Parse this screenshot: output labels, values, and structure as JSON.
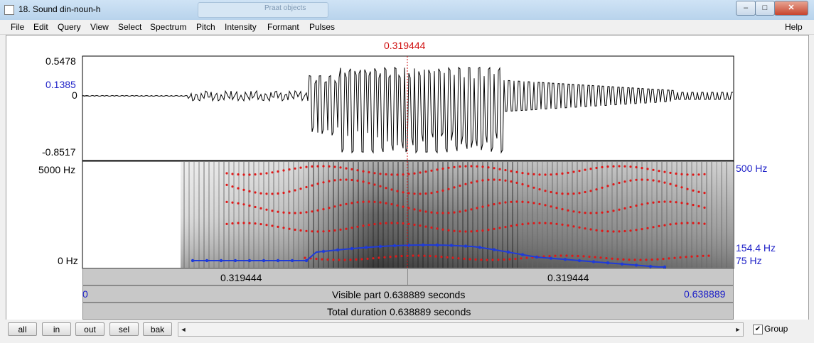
{
  "window": {
    "title": "18. Sound din-noun-h",
    "ghost_tab_label": "Praat objects",
    "min_symbol": "–",
    "max_symbol": "□",
    "close_symbol": "✕"
  },
  "menu": {
    "items": [
      "File",
      "Edit",
      "Query",
      "View",
      "Select",
      "Spectrum",
      "Pitch",
      "Intensity",
      "Formant",
      "Pulses"
    ],
    "help": "Help"
  },
  "waveform": {
    "cursor_time_label": "0.319444",
    "y_max_label": "0.5478",
    "y_cursor_value_label": "0.1385",
    "y_zero_label": "0",
    "y_min_label": "-0.8517"
  },
  "spectrogram": {
    "freq_max_label": "5000 Hz",
    "freq_min_label": "0 Hz",
    "pitch_max_label": "500 Hz",
    "pitch_cursor_label": "154.4 Hz",
    "pitch_min_label": "75 Hz"
  },
  "selection_bar": {
    "left_duration": "0.319444",
    "right_duration": "0.319444"
  },
  "visible_bar": {
    "start": "0",
    "label": "Visible part 0.638889 seconds",
    "end": "0.638889"
  },
  "total_bar": {
    "label": "Total duration 0.638889 seconds"
  },
  "toolbar": {
    "buttons": [
      "all",
      "in",
      "out",
      "sel",
      "bak"
    ],
    "scroll_left_symbol": "◄",
    "scroll_right_symbol": "►",
    "group_checked": true,
    "group_check_symbol": "✔",
    "group_label": "Group"
  },
  "colors": {
    "cursor": "#d01010",
    "axis_labels": "#1f22c8",
    "formant_dots": "#e01818",
    "pitch_line": "#1f3bd8"
  },
  "icons": {
    "app": "praat-window-icon",
    "checkbox": "checkbox-icon"
  }
}
